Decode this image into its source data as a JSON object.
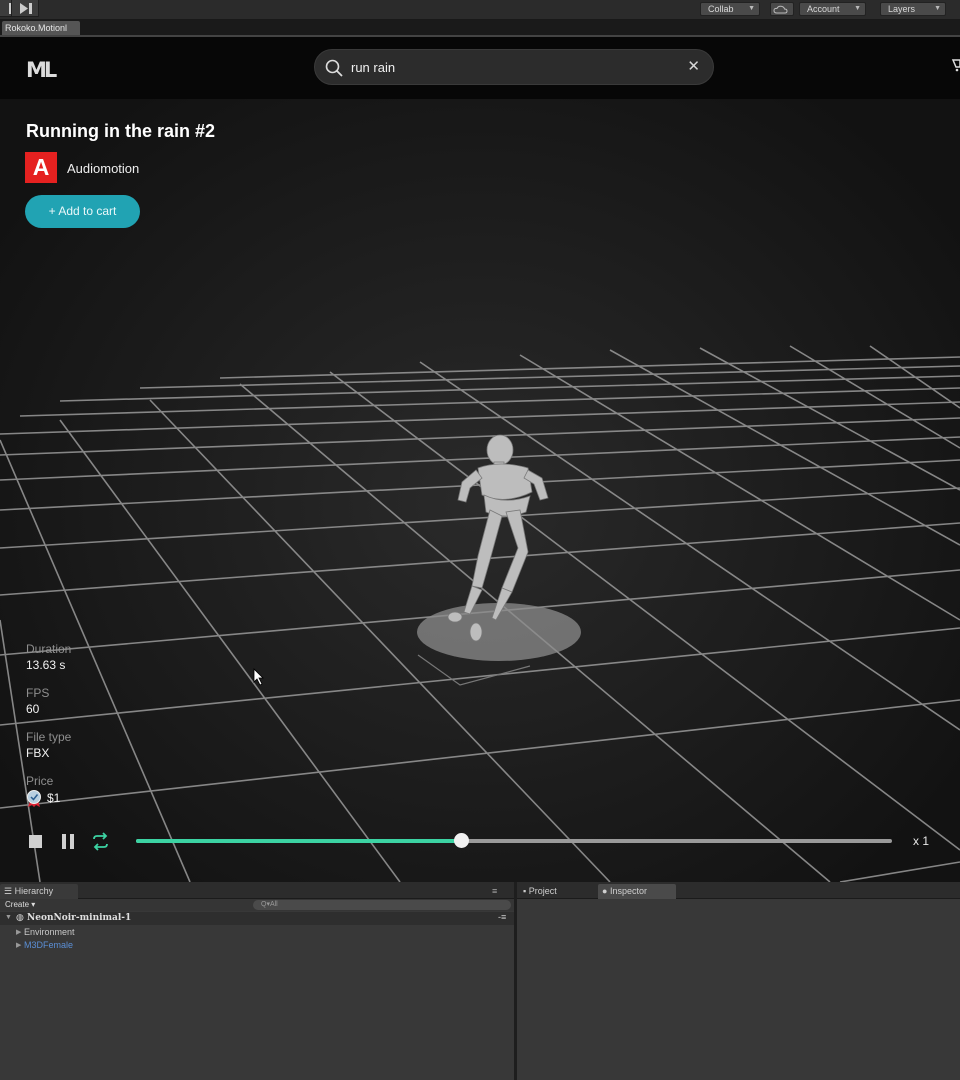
{
  "unity": {
    "toolbar": {
      "collab_label": "Collab",
      "account_label": "Account",
      "layers_label": "Layers"
    },
    "game_tab_label": "Rokoko.Motionl",
    "hierarchy": {
      "tab_label": "Hierarchy",
      "create_label": "Create",
      "search_placeholder": "Q▾All",
      "scene_name": "NeonNoir-minimal-1",
      "items": [
        {
          "label": "Environment",
          "color": "#c8c8c8"
        },
        {
          "label": "M3DFemale",
          "color": "#5b8fd6"
        }
      ]
    },
    "project_tab_label": "Project",
    "inspector_tab_label": "Inspector"
  },
  "app": {
    "logo_text": "ML",
    "search": {
      "value": "run rain",
      "clear_icon": "close-icon"
    },
    "motion": {
      "title": "Running in the rain #2",
      "author_initial": "A",
      "author_name": "Audiomotion",
      "add_to_cart_label": "+ Add to cart",
      "accent_color": "#21a3b3"
    },
    "meta": [
      {
        "key": "Duration",
        "value": "13.63 s"
      },
      {
        "key": "FPS",
        "value": "60"
      },
      {
        "key": "File type",
        "value": "FBX"
      },
      {
        "key": "Price",
        "value": "$1"
      }
    ],
    "player": {
      "progress": 0.43,
      "speed_label": "x 1",
      "progress_color": "#3cd3a3"
    }
  }
}
